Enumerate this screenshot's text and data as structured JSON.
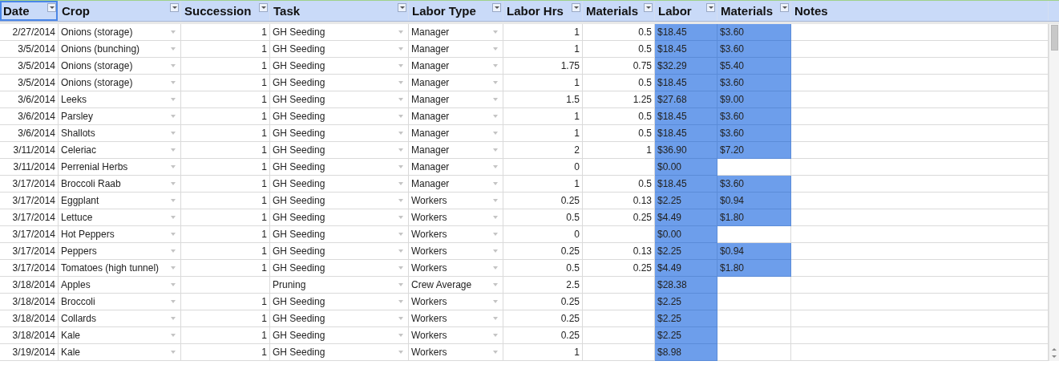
{
  "columns": [
    {
      "label": "Date",
      "kind": "date",
      "filter": true,
      "selected": true
    },
    {
      "label": "Crop",
      "kind": "dropdown",
      "filter": true,
      "selected": false
    },
    {
      "label": "Succession",
      "kind": "number",
      "filter": true,
      "selected": false
    },
    {
      "label": "Task",
      "kind": "dropdown",
      "filter": true,
      "selected": false
    },
    {
      "label": "Labor Type",
      "kind": "dropdown",
      "filter": true,
      "selected": false
    },
    {
      "label": "Labor Hrs",
      "kind": "number",
      "filter": true,
      "selected": false
    },
    {
      "label": "Materials",
      "kind": "number",
      "filter": true,
      "selected": false
    },
    {
      "label": "Labor",
      "kind": "currency",
      "filter": true,
      "selected": false
    },
    {
      "label": "Materials",
      "kind": "currency",
      "filter": true,
      "selected": false
    },
    {
      "label": "Notes",
      "kind": "text",
      "filter": false,
      "selected": false
    }
  ],
  "rows": [
    {
      "cells": [
        "2/27/2014",
        "Onions (storage)",
        "1",
        "GH Seeding",
        "Manager",
        "1",
        "0.5",
        "$18.45",
        "$3.60",
        null
      ]
    },
    {
      "cells": [
        "3/5/2014",
        "Onions (bunching)",
        "1",
        "GH Seeding",
        "Manager",
        "1",
        "0.5",
        "$18.45",
        "$3.60",
        null
      ]
    },
    {
      "cells": [
        "3/5/2014",
        "Onions (storage)",
        "1",
        "GH Seeding",
        "Manager",
        "1.75",
        "0.75",
        "$32.29",
        "$5.40",
        null
      ]
    },
    {
      "cells": [
        "3/5/2014",
        "Onions (storage)",
        "1",
        "GH Seeding",
        "Manager",
        "1",
        "0.5",
        "$18.45",
        "$3.60",
        null
      ]
    },
    {
      "cells": [
        "3/6/2014",
        "Leeks",
        "1",
        "GH Seeding",
        "Manager",
        "1.5",
        "1.25",
        "$27.68",
        "$9.00",
        null
      ]
    },
    {
      "cells": [
        "3/6/2014",
        "Parsley",
        "1",
        "GH Seeding",
        "Manager",
        "1",
        "0.5",
        "$18.45",
        "$3.60",
        null
      ]
    },
    {
      "cells": [
        "3/6/2014",
        "Shallots",
        "1",
        "GH Seeding",
        "Manager",
        "1",
        "0.5",
        "$18.45",
        "$3.60",
        null
      ]
    },
    {
      "cells": [
        "3/11/2014",
        "Celeriac",
        "1",
        "GH Seeding",
        "Manager",
        "2",
        "1",
        "$36.90",
        "$7.20",
        null
      ]
    },
    {
      "cells": [
        "3/11/2014",
        "Perrenial Herbs",
        "1",
        "GH Seeding",
        "Manager",
        "0",
        null,
        "$0.00",
        null,
        null
      ]
    },
    {
      "cells": [
        "3/17/2014",
        "Broccoli Raab",
        "1",
        "GH Seeding",
        "Manager",
        "1",
        "0.5",
        "$18.45",
        "$3.60",
        null
      ]
    },
    {
      "cells": [
        "3/17/2014",
        "Eggplant",
        "1",
        "GH Seeding",
        "Workers",
        "0.25",
        "0.13",
        "$2.25",
        "$0.94",
        null
      ]
    },
    {
      "cells": [
        "3/17/2014",
        "Lettuce",
        "1",
        "GH Seeding",
        "Workers",
        "0.5",
        "0.25",
        "$4.49",
        "$1.80",
        null
      ]
    },
    {
      "cells": [
        "3/17/2014",
        "Hot Peppers",
        "1",
        "GH Seeding",
        "Workers",
        "0",
        null,
        "$0.00",
        null,
        null
      ]
    },
    {
      "cells": [
        "3/17/2014",
        "Peppers",
        "1",
        "GH Seeding",
        "Workers",
        "0.25",
        "0.13",
        "$2.25",
        "$0.94",
        null
      ]
    },
    {
      "cells": [
        "3/17/2014",
        "Tomatoes (high tunnel)",
        "1",
        "GH Seeding",
        "Workers",
        "0.5",
        "0.25",
        "$4.49",
        "$1.80",
        null
      ]
    },
    {
      "cells": [
        "3/18/2014",
        "Apples",
        null,
        "Pruning",
        "Crew Average",
        "2.5",
        null,
        "$28.38",
        null,
        null
      ]
    },
    {
      "cells": [
        "3/18/2014",
        "Broccoli",
        "1",
        "GH Seeding",
        "Workers",
        "0.25",
        null,
        "$2.25",
        null,
        null
      ]
    },
    {
      "cells": [
        "3/18/2014",
        "Collards",
        "1",
        "GH Seeding",
        "Workers",
        "0.25",
        null,
        "$2.25",
        null,
        null
      ]
    },
    {
      "cells": [
        "3/18/2014",
        "Kale",
        "1",
        "GH Seeding",
        "Workers",
        "0.25",
        null,
        "$2.25",
        null,
        null
      ]
    },
    {
      "cells": [
        "3/19/2014",
        "Kale",
        "1",
        "GH Seeding",
        "Workers",
        "1",
        null,
        "$8.98",
        null,
        null
      ]
    }
  ]
}
